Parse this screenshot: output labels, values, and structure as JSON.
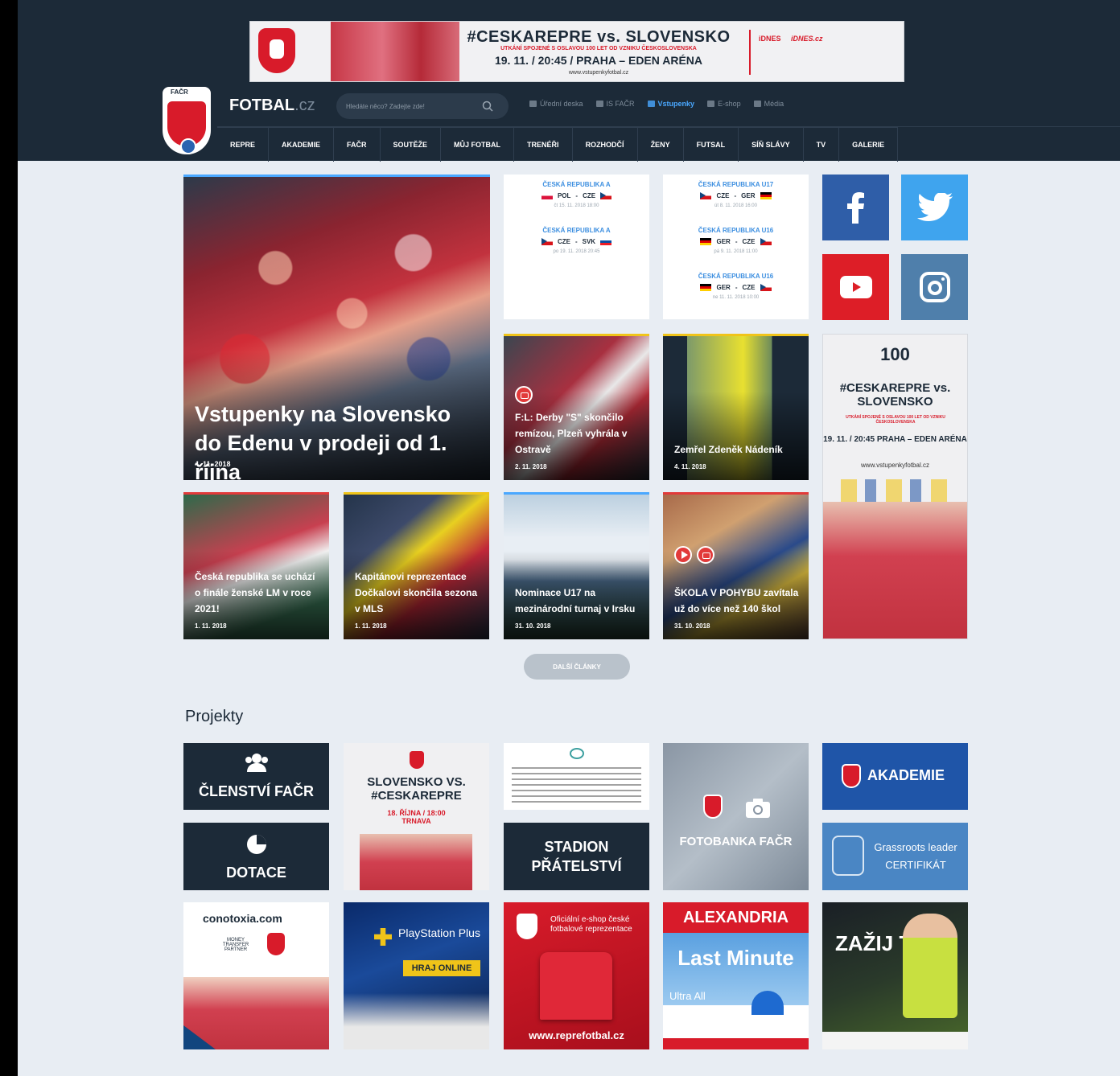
{
  "banner": {
    "title": "#CESKAREPRE vs. SLOVENSKO",
    "subtitle": "UTKÁNÍ SPOJENÉ S OSLAVOU 100 LET OD VZNIKU ČESKOSLOVENSKA",
    "when": "19. 11. / 20:45 / PRAHA – EDEN ARÉNA",
    "url": "www.vstupenkyfotbal.cz",
    "sponsor1": "iDNES",
    "sponsor2": "iDNES.cz"
  },
  "site": {
    "name": "FOTBAL",
    "tld": ".cz",
    "logo_text": "FAČR"
  },
  "search": {
    "placeholder": "Hledáte něco? Zadejte zde!"
  },
  "toplinks": [
    {
      "label": "Úřední deska",
      "icon": "notice-icon"
    },
    {
      "label": "IS FAČR",
      "icon": "pencil-icon"
    },
    {
      "label": "Vstupenky",
      "icon": "ticket-icon"
    },
    {
      "label": "E-shop",
      "icon": "cart-icon"
    },
    {
      "label": "Média",
      "icon": "media-icon"
    }
  ],
  "nav": [
    "REPRE",
    "AKADEMIE",
    "FAČR",
    "SOUTĚŽE",
    "MŮJ FOTBAL",
    "TRENÉŘI",
    "ROZHODČÍ",
    "ŽENY",
    "FUTSAL",
    "SÍŇ SLÁVY",
    "TV",
    "GALERIE"
  ],
  "hero": {
    "title": "Vstupenky na Slovensko do Edenu v prodeji od 1. října",
    "date": "4. 11. 2018"
  },
  "matches_left": [
    {
      "competition": "ČESKÁ REPUBLIKA A",
      "home": "POL",
      "away": "CZE",
      "home_flag": "pol",
      "away_flag": "cze",
      "when": "čt 15. 11. 2018 18:00"
    },
    {
      "competition": "ČESKÁ REPUBLIKA A",
      "home": "CZE",
      "away": "SVK",
      "home_flag": "cze",
      "away_flag": "svk",
      "when": "po 19. 11. 2018 20:45"
    }
  ],
  "matches_right": [
    {
      "competition": "ČESKÁ REPUBLIKA U17",
      "home": "CZE",
      "away": "GER",
      "home_flag": "cze",
      "away_flag": "ger",
      "when": "út 8. 11. 2018 16:00"
    },
    {
      "competition": "ČESKÁ REPUBLIKA U16",
      "home": "GER",
      "away": "CZE",
      "home_flag": "ger",
      "away_flag": "cze",
      "when": "pá 9. 11. 2018 11:00"
    },
    {
      "competition": "ČESKÁ REPUBLIKA U16",
      "home": "GER",
      "away": "CZE",
      "home_flag": "ger",
      "away_flag": "cze",
      "when": "ne 11. 11. 2018 10:00"
    }
  ],
  "news": [
    {
      "title": "F:L: Derby \"S\" skončilo remízou, Plzeň vyhrála v Ostravě",
      "date": "2. 11. 2018"
    },
    {
      "title": "Zemřel Zdeněk Nádeník",
      "date": "4. 11. 2018"
    },
    {
      "title": "Česká republika se uchází o finále ženské LM v roce 2021!",
      "date": "1. 11. 2018"
    },
    {
      "title": "Kapitánovi reprezentace Dočkalovi skončila sezona v MLS",
      "date": "1. 11. 2018"
    },
    {
      "title": "Nominace U17 na mezinárodní turnaj v Irsku",
      "date": "31. 10. 2018"
    },
    {
      "title": "ŠKOLA V POHYBU zavítala už do více než 140 škol",
      "date": "31. 10. 2018"
    }
  ],
  "side_ad": {
    "hundred": "100",
    "title": "#CESKAREPRE vs. SLOVENSKO",
    "sub": "UTKÁNÍ SPOJENÉ S OSLAVOU 100 LET OD VZNIKU ČESKOSLOVENSKA",
    "when": "19. 11. / 20:45 PRAHA – EDEN ARÉNA",
    "url": "www.vstupenkyfotbal.cz"
  },
  "more_button": "DALŠÍ ČLÁNKY",
  "projects_title": "Projekty",
  "projects": {
    "membership": "ČLENSTVÍ FAČR",
    "dotace": "DOTACE",
    "svk_ad_title": "SLOVENSKO VS. #CESKAREPRE",
    "svk_ad_when": "18. ŘÍJNA / 18:00 TRNAVA",
    "stadion": "STADION PŘÁTELSTVÍ",
    "fotobanka": "FOTOBANKA FAČR",
    "akademie": "AKADEMIE",
    "grassroots": "Grassroots leader CERTIFIKÁT",
    "conotoxia": "conotoxia.com",
    "money_partner": "MONEY TRANSFER PARTNER",
    "playstation": "PlayStation Plus",
    "play_online": "HRAJ ONLINE",
    "eshop_title": "Oficiální e-shop české fotbalové reprezentace",
    "eshop_url": "www.reprefotbal.cz",
    "alexandria": "ALEXANDRIA",
    "last_minute": "Last Minute",
    "ultra": "Ultra All Inclusive",
    "zaziju": "ZAŽIJ TO"
  }
}
